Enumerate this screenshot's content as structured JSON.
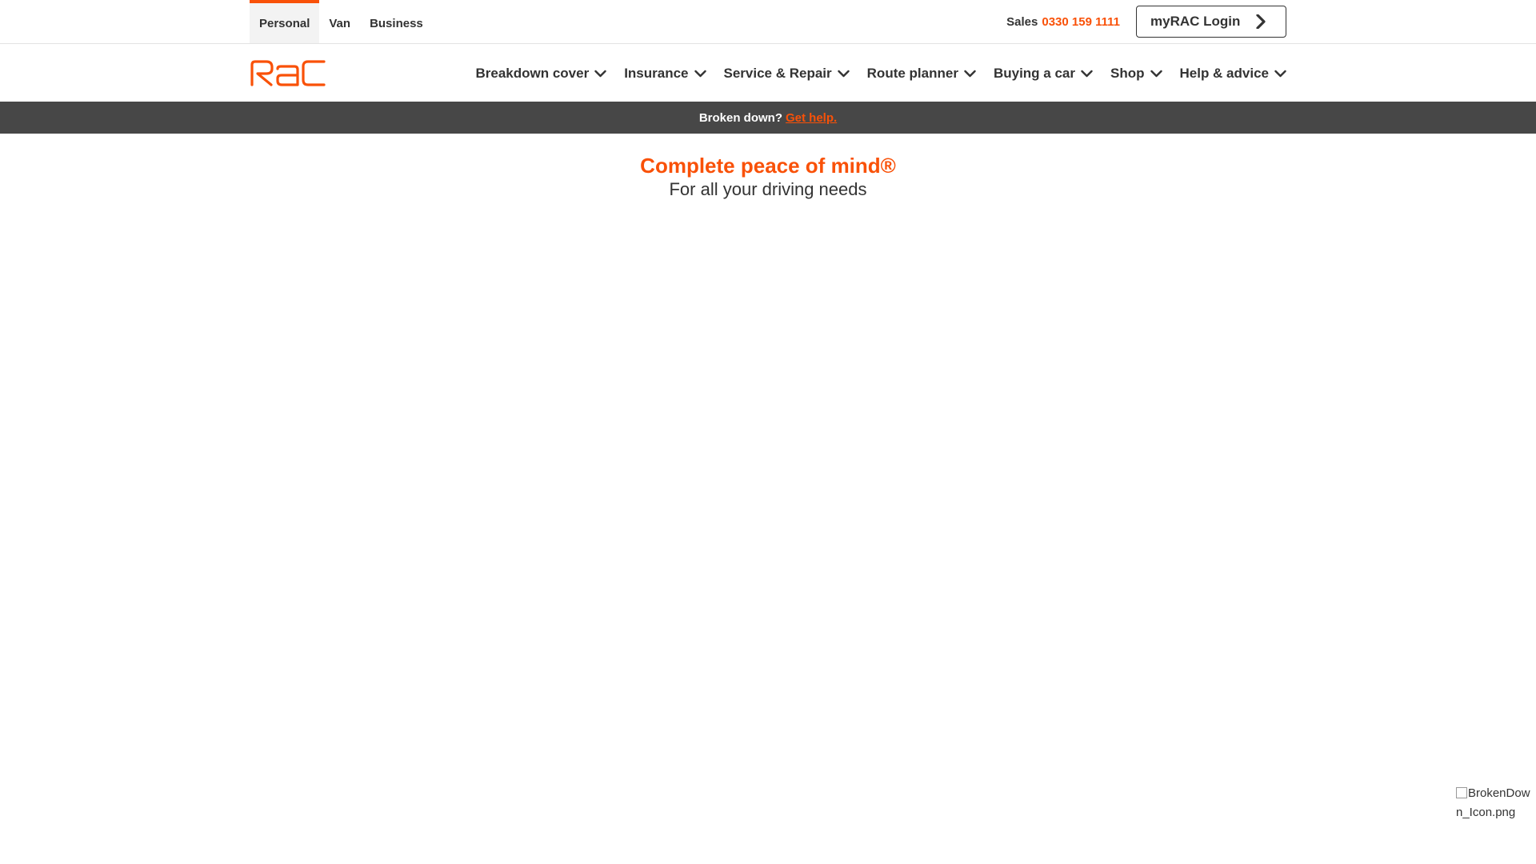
{
  "topbar": {
    "segments": [
      {
        "label": "Personal",
        "active": true
      },
      {
        "label": "Van",
        "active": false
      },
      {
        "label": "Business",
        "active": false
      }
    ],
    "sales_label": "Sales",
    "sales_number": "0330 159 1111",
    "login_label": "myRAC Login"
  },
  "mainnav": {
    "logo_text": "RAC",
    "items": [
      {
        "label": "Breakdown cover"
      },
      {
        "label": "Insurance"
      },
      {
        "label": "Service & Repair"
      },
      {
        "label": "Route planner"
      },
      {
        "label": "Buying a car"
      },
      {
        "label": "Shop"
      },
      {
        "label": "Help & advice"
      }
    ]
  },
  "alert": {
    "text": "Broken down?",
    "link": "Get help."
  },
  "hero": {
    "title": "Complete peace of mind®",
    "subtitle": "For all your driving needs"
  },
  "floating": {
    "broken_image_alt": "BrokenDown_Icon.png"
  },
  "colors": {
    "brand": "#f95108",
    "text": "#333333",
    "alert_bg": "#474747"
  }
}
